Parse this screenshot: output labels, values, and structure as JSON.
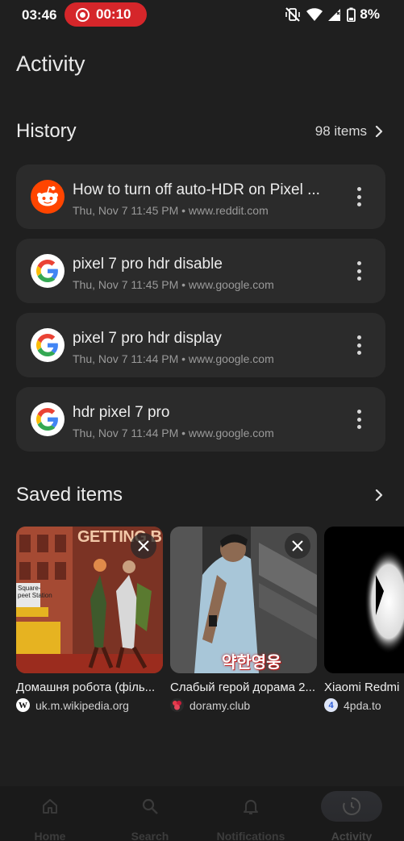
{
  "status_bar": {
    "time": "03:46",
    "recording_time": "00:10",
    "battery": "8%"
  },
  "page": {
    "title": "Activity"
  },
  "history": {
    "title": "History",
    "count_label": "98 items",
    "items": [
      {
        "title": "How to turn off auto-HDR on Pixel ...",
        "meta": "Thu, Nov 7 11:45 PM • www.reddit.com",
        "icon": "reddit-icon"
      },
      {
        "title": "pixel 7 pro hdr disable",
        "meta": "Thu, Nov 7 11:45 PM • www.google.com",
        "icon": "google-icon"
      },
      {
        "title": "pixel 7 pro hdr display",
        "meta": "Thu, Nov 7 11:44 PM • www.google.com",
        "icon": "google-icon"
      },
      {
        "title": "hdr pixel 7 pro",
        "meta": "Thu, Nov 7 11:44 PM • www.google.com",
        "icon": "google-icon"
      }
    ]
  },
  "saved": {
    "title": "Saved items",
    "items": [
      {
        "title": "Домашня робота (філь...",
        "source": "uk.m.wikipedia.org",
        "thumb_text": "GETTING BY",
        "sign_text": "Square-\npeet Station"
      },
      {
        "title": "Слабый герой дорама 2...",
        "source": "doramy.club",
        "thumb_text": "약한영웅"
      },
      {
        "title": "Xiaomi Redmi",
        "source": "4pda.to"
      }
    ]
  },
  "nav": {
    "items": [
      {
        "label": "Home",
        "icon": "home-icon"
      },
      {
        "label": "Search",
        "icon": "search-icon"
      },
      {
        "label": "Notifications",
        "icon": "bell-icon"
      },
      {
        "label": "Activity",
        "icon": "activity-icon",
        "active": true
      }
    ]
  },
  "colors": {
    "background": "#1f1f1f",
    "card": "#2b2b2b",
    "recording": "#d5262a",
    "reddit": "#ff4500"
  }
}
